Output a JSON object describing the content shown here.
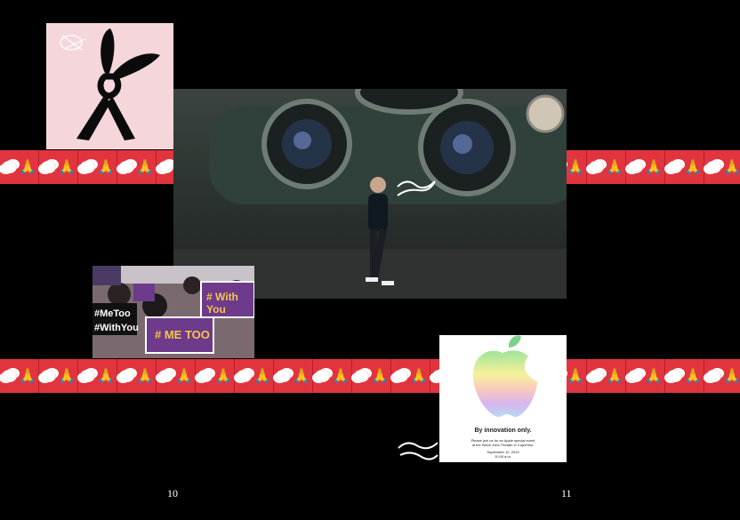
{
  "pages": {
    "left_number": "10",
    "right_number": "11"
  },
  "bands": {
    "tile_icon": "cloud-and-praying-hands-emoji",
    "background": "#e2343e",
    "hands_color": "#ffc21a",
    "hands_glyph": "🙏"
  },
  "protest": {
    "sign_metoo": "# ME TOO",
    "sign_withyou": "# With You",
    "sign_hashtag_metoo": "#MeToo",
    "sign_hashtag_withyou": "#WithYou"
  },
  "invite": {
    "headline": "By innovation only.",
    "body_line1": "Please join us for an Apple special event",
    "body_line2": "at the Steve Jobs Theater in Cupertino.",
    "date": "September 10, 2019",
    "time": "10:00 a.m."
  }
}
